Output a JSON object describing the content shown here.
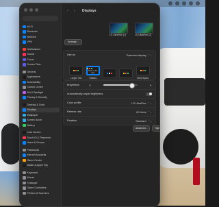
{
  "window": {
    "title": "Displays",
    "nav": {
      "back": "‹",
      "forward": "›"
    }
  },
  "colors": {
    "accent": "#0a84ff",
    "panel": "#2b2b2b",
    "sidebar": "#2a2a2a"
  },
  "sidebar": {
    "items": [
      {
        "label": "Wi-Fi",
        "icon": "wifi-icon",
        "color": "#0a84ff"
      },
      {
        "label": "Bluetooth",
        "icon": "bluetooth-icon",
        "color": "#0a84ff"
      },
      {
        "label": "Network",
        "icon": "network-icon",
        "color": "#0a84ff"
      },
      {
        "label": "VPN",
        "icon": "vpn-icon",
        "color": "#0a84ff"
      },
      {
        "label": "Notifications",
        "icon": "bell-icon",
        "color": "#ff3b30",
        "sep": true
      },
      {
        "label": "Sound",
        "icon": "speaker-icon",
        "color": "#ff2d55"
      },
      {
        "label": "Focus",
        "icon": "moon-icon",
        "color": "#5e5ce6"
      },
      {
        "label": "Screen Time",
        "icon": "hourglass-icon",
        "color": "#5e5ce6"
      },
      {
        "label": "General",
        "icon": "gear-icon",
        "color": "#8e8e93",
        "sep": true
      },
      {
        "label": "Appearance",
        "icon": "appearance-icon",
        "color": "#1c1c1e"
      },
      {
        "label": "Accessibility",
        "icon": "accessibility-icon",
        "color": "#0a84ff"
      },
      {
        "label": "Control Centre",
        "icon": "control-centre-icon",
        "color": "#8e8e93"
      },
      {
        "label": "Siri & Spotlight",
        "icon": "siri-icon",
        "color": "#bf5af2"
      },
      {
        "label": "Privacy & Security",
        "icon": "hand-icon",
        "color": "#0a84ff"
      },
      {
        "label": "Desktop & Dock",
        "icon": "dock-icon",
        "color": "#1c1c1e",
        "sep": true
      },
      {
        "label": "Displays",
        "icon": "display-icon",
        "color": "#0a84ff",
        "active": true
      },
      {
        "label": "Wallpaper",
        "icon": "wallpaper-icon",
        "color": "#32ade6"
      },
      {
        "label": "Screen Saver",
        "icon": "screensaver-icon",
        "color": "#32ade6"
      },
      {
        "label": "Battery",
        "icon": "battery-icon",
        "color": "#30d158"
      },
      {
        "label": "Lock Screen",
        "icon": "lock-icon",
        "color": "#1c1c1e",
        "sep": true
      },
      {
        "label": "Touch ID & Password",
        "icon": "fingerprint-icon",
        "color": "#ff375f"
      },
      {
        "label": "Users & Groups",
        "icon": "users-icon",
        "color": "#0a84ff"
      },
      {
        "label": "Passwords",
        "icon": "key-icon",
        "color": "#8e8e93",
        "sep": true
      },
      {
        "label": "Internet Accounts",
        "icon": "at-icon",
        "color": "#0a84ff"
      },
      {
        "label": "Game Center",
        "icon": "gamecenter-icon",
        "color": "#ff9f0a"
      },
      {
        "label": "Wallet & Apple Pay",
        "icon": "wallet-icon",
        "color": "#1c1c1e"
      },
      {
        "label": "Keyboard",
        "icon": "keyboard-icon",
        "color": "#8e8e93",
        "sep": true
      },
      {
        "label": "Mouse",
        "icon": "mouse-icon",
        "color": "#8e8e93"
      },
      {
        "label": "Trackpad",
        "icon": "trackpad-icon",
        "color": "#8e8e93"
      },
      {
        "label": "Game Controllers",
        "icon": "controller-icon",
        "color": "#8e8e93"
      },
      {
        "label": "Printers & Scanners",
        "icon": "printer-icon",
        "color": "#8e8e93"
      }
    ]
  },
  "main": {
    "arrange_button": "Arrange...",
    "monitors": [
      {
        "label": "LG UltraFine (1)"
      },
      {
        "label": "LG UltraFine (2)"
      }
    ],
    "use_as": {
      "label": "Use as",
      "value": "Extended display",
      "arrows": "⌃⌄"
    },
    "resolution_options": [
      {
        "label": "Larger Text",
        "caption": "",
        "selected": false,
        "dots": [
          "#ffd60a",
          "#ff453a",
          "#30d158"
        ]
      },
      {
        "label": "Default",
        "caption": "Here's to the crazy",
        "selected": true,
        "dots": [
          "#ffd60a",
          "#ff453a",
          "#30d158"
        ]
      },
      {
        "label": "",
        "caption": "",
        "selected": false,
        "dots": [
          "#0a84ff",
          "#ffffff",
          "#ff453a"
        ]
      },
      {
        "label": "",
        "caption": "",
        "selected": false,
        "dots": [
          "#ffd60a",
          "#ff453a",
          "#30d158"
        ]
      },
      {
        "label": "More Space",
        "caption": "",
        "selected": false,
        "dots": [
          "#ffd60a",
          "#ff453a",
          "#30d158"
        ]
      }
    ],
    "brightness": {
      "label": "Brightness",
      "level": 0.82
    },
    "auto_brightness": {
      "label": "Automatically adjust brightness",
      "enabled": false
    },
    "color_profile": {
      "label": "Color profile",
      "value": "LG UltraFine",
      "arrows": "⌃⌄"
    },
    "refresh_rate": {
      "label": "Refresh rate",
      "value": "60 Hertz",
      "arrows": "⌃⌄"
    },
    "rotation": {
      "label": "Rotation",
      "value": "Standard",
      "arrows": "⌃⌄"
    },
    "advanced_button": "Advanced...",
    "night_shift_button": "Night Shift...",
    "help_button": "?"
  }
}
